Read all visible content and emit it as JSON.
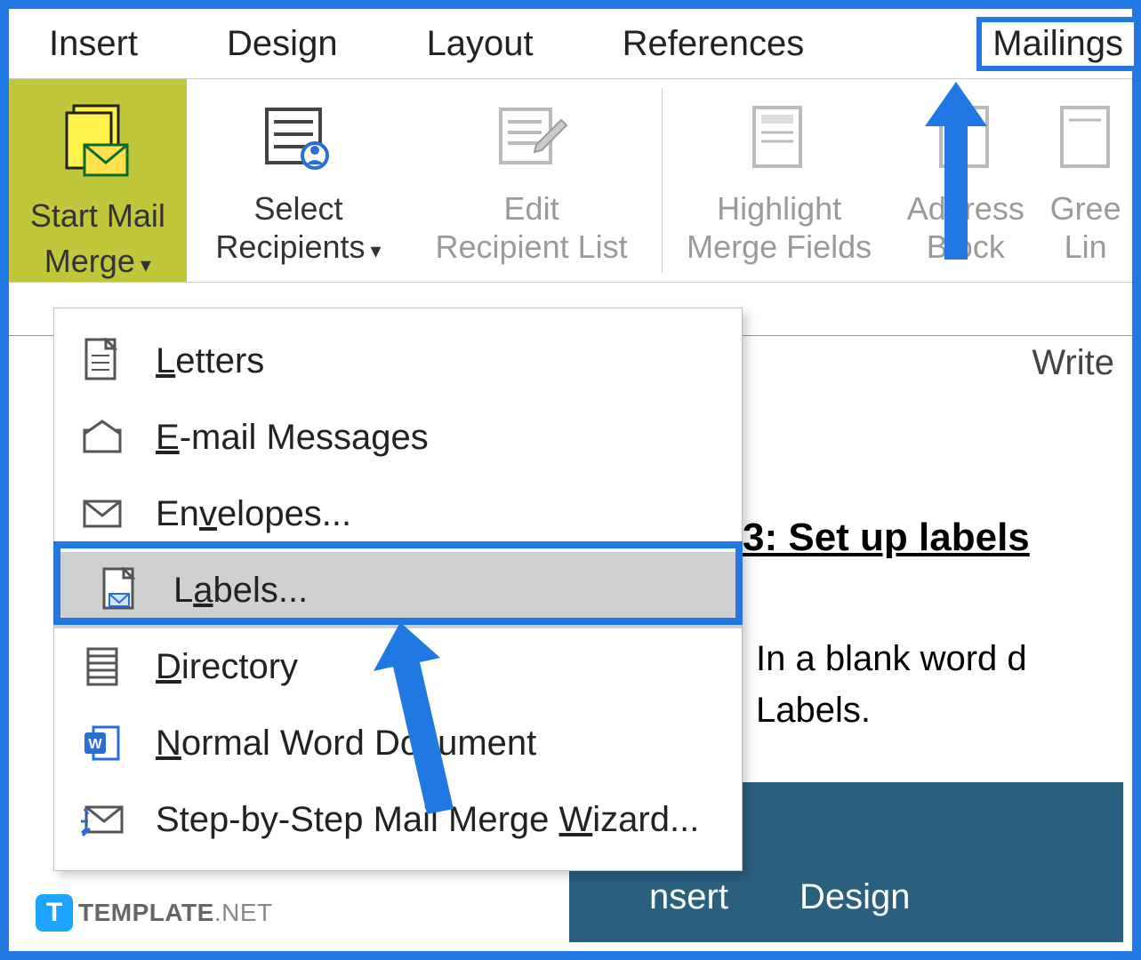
{
  "tabs": {
    "insert": "Insert",
    "design": "Design",
    "layout": "Layout",
    "references": "References",
    "mailings": "Mailings"
  },
  "ribbon": {
    "start_mail_merge_l1": "Start Mail",
    "start_mail_merge_l2": "Merge",
    "select_l1": "Select",
    "select_l2": "Recipients",
    "edit_l1": "Edit",
    "edit_l2": "Recipient List",
    "highlight_l1": "Highlight",
    "highlight_l2": "Merge Fields",
    "address_l1": "Address",
    "address_l2": "Block",
    "greeting_l1": "Gree",
    "greeting_l2": "Lin",
    "group_write": "Write"
  },
  "menu": {
    "letters": "etters",
    "letters_u": "L",
    "email": "-mail Messages",
    "email_u": "E",
    "envelopes": "En",
    "envelopes_rest": "elopes...",
    "envelopes_u": "v",
    "labels": "L",
    "labels_rest": "bels...",
    "labels_u": "a",
    "directory": "irectory",
    "directory_u": "D",
    "normal": "ormal Word Document",
    "normal_u": "N",
    "wizard": "Step-by-Step Mail Merge ",
    "wizard_rest": "izard...",
    "wizard_u": "W"
  },
  "document": {
    "title_partial": "3: Set up labels",
    "para_l1": "In a blank word d",
    "para_l2": "Labels."
  },
  "bottom": {
    "insert": "nsert",
    "design": "Design"
  },
  "watermark": {
    "t": "T",
    "template": "TEMPLATE",
    "net": ".NET"
  }
}
